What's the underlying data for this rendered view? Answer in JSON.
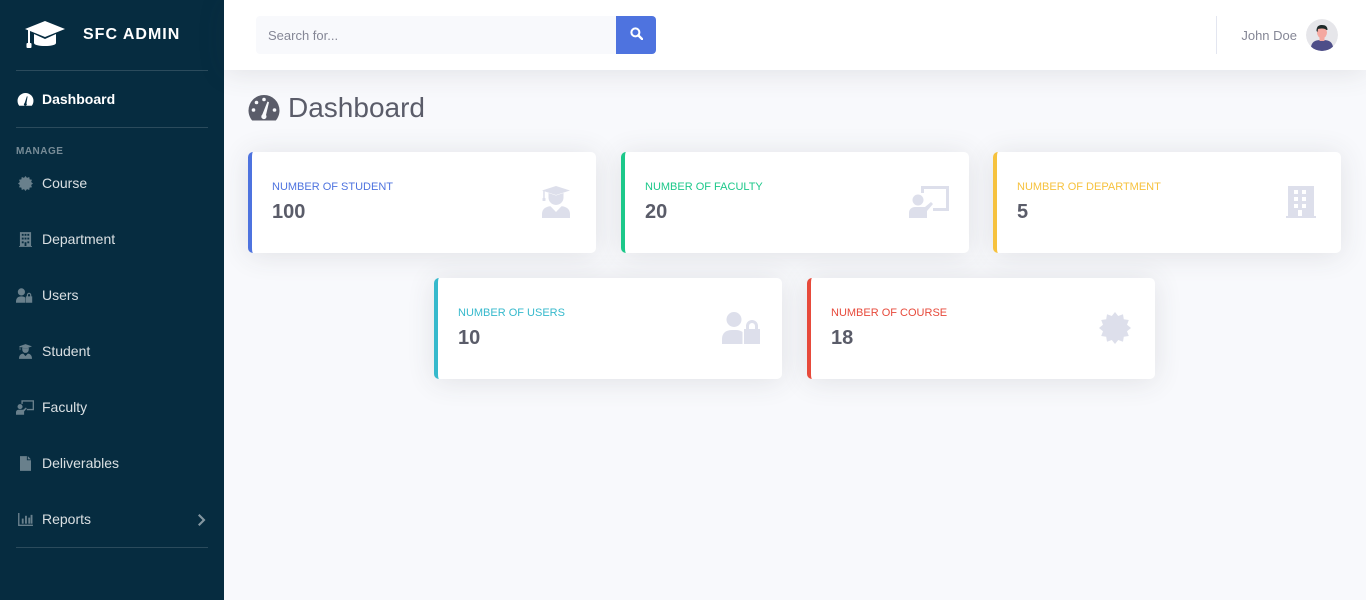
{
  "sidebar": {
    "brand": "SFC ADMIN",
    "active_item": "Dashboard",
    "heading": "MANAGE",
    "items": [
      {
        "label": "Course",
        "icon": "certificate-icon"
      },
      {
        "label": "Department",
        "icon": "building-icon"
      },
      {
        "label": "Users",
        "icon": "user-lock-icon"
      },
      {
        "label": "Student",
        "icon": "user-graduate-icon"
      },
      {
        "label": "Faculty",
        "icon": "chalkboard-teacher-icon"
      },
      {
        "label": "Deliverables",
        "icon": "file-icon"
      },
      {
        "label": "Reports",
        "icon": "chart-bar-icon",
        "has_submenu": true
      }
    ]
  },
  "topbar": {
    "search_placeholder": "Search for...",
    "search_value": "",
    "user_name": "John Doe"
  },
  "page": {
    "title": "Dashboard"
  },
  "cards": [
    {
      "label": "Number of Student",
      "value": "100",
      "color": "#4e73df",
      "icon": "user-graduate-icon"
    },
    {
      "label": "Number of Faculty",
      "value": "20",
      "color": "#1cc88a",
      "icon": "chalkboard-teacher-icon"
    },
    {
      "label": "Number of Department",
      "value": "5",
      "color": "#f6c23e",
      "icon": "building-icon"
    },
    {
      "label": "Number of Users",
      "value": "10",
      "color": "#36b9cc",
      "icon": "user-lock-icon"
    },
    {
      "label": "Number of Course",
      "value": "18",
      "color": "#e74a3b",
      "icon": "certificate-icon"
    }
  ],
  "colors": {
    "sidebar_bg": "#062c40",
    "primary": "#4e73df",
    "success": "#1cc88a",
    "warning": "#f6c23e",
    "info": "#36b9cc",
    "danger": "#e74a3b"
  }
}
